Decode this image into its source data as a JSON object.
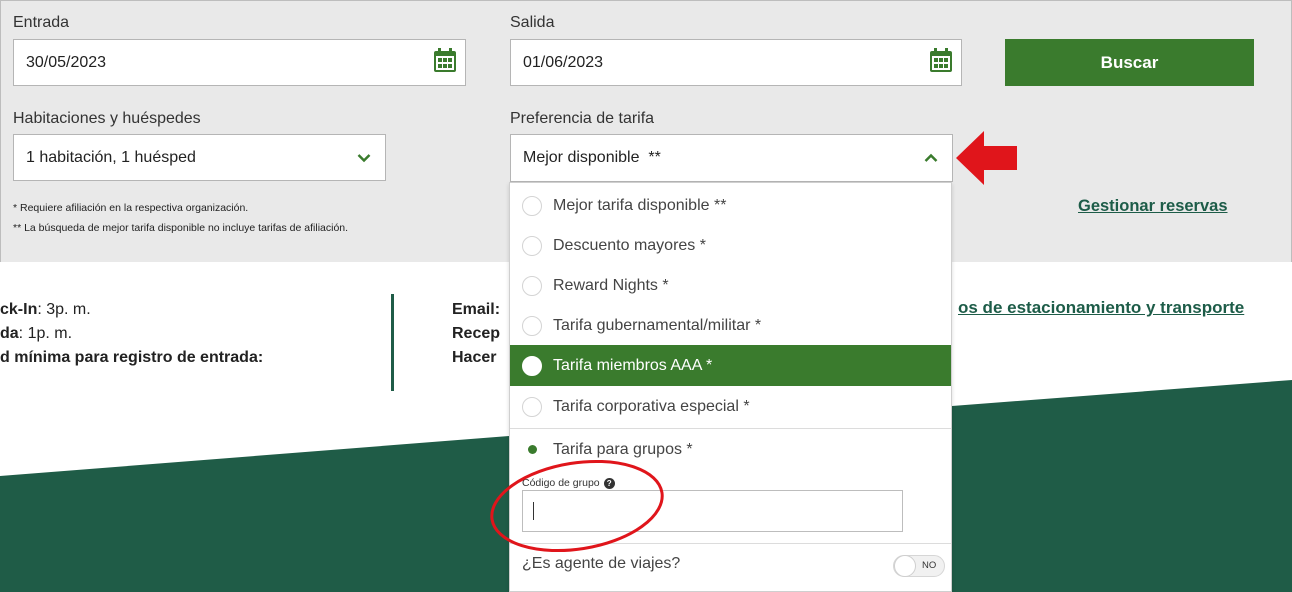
{
  "search": {
    "checkin_label": "Entrada",
    "checkin_value": "30/05/2023",
    "checkout_label": "Salida",
    "checkout_value": "01/06/2023",
    "search_button": "Buscar",
    "rooms_label": "Habitaciones y huéspedes",
    "rooms_value": "1 habitación, 1 huésped",
    "rate_label": "Preferencia de tarifa",
    "rate_value": "Mejor disponible  **",
    "note_membership": "* Requiere afiliación en la respectiva organización.",
    "note_best_rate": "** La búsqueda de mejor tarifa disponible no incluye tarifas de afiliación.",
    "manage_link": "Gestionar reservas"
  },
  "rate_options": [
    {
      "label": "Mejor tarifa disponible **",
      "state": "unselected"
    },
    {
      "label": "Descuento mayores *",
      "state": "unselected"
    },
    {
      "label": "Reward Nights *",
      "state": "unselected"
    },
    {
      "label": "Tarifa gubernamental/militar *",
      "state": "unselected"
    },
    {
      "label": "Tarifa miembros AAA *",
      "state": "highlighted"
    },
    {
      "label": "Tarifa corporativa especial *",
      "state": "unselected"
    },
    {
      "label": "Tarifa para grupos *",
      "state": "checked"
    }
  ],
  "group": {
    "code_label": "Código de grupo",
    "code_value": "",
    "agent_question": "¿Es agente de viajes?",
    "agent_toggle": "NO"
  },
  "hotel_info": {
    "checkin_label": "ck-In",
    "checkin_value": ": 3p. m.",
    "checkout_label": "da",
    "checkout_value": ": 1p. m.",
    "min_age_label": "d mínima para registro de entrada:",
    "email_label": "Email:",
    "reception_label": "Recep",
    "do_label": "Hacer",
    "transport_link": "os de estacionamiento y transporte"
  },
  "colors": {
    "brand_green": "#3a7b2d",
    "dark_green": "#1f5c47",
    "panel_gray": "#e9e9e9",
    "annotation_red": "#e0151b"
  }
}
